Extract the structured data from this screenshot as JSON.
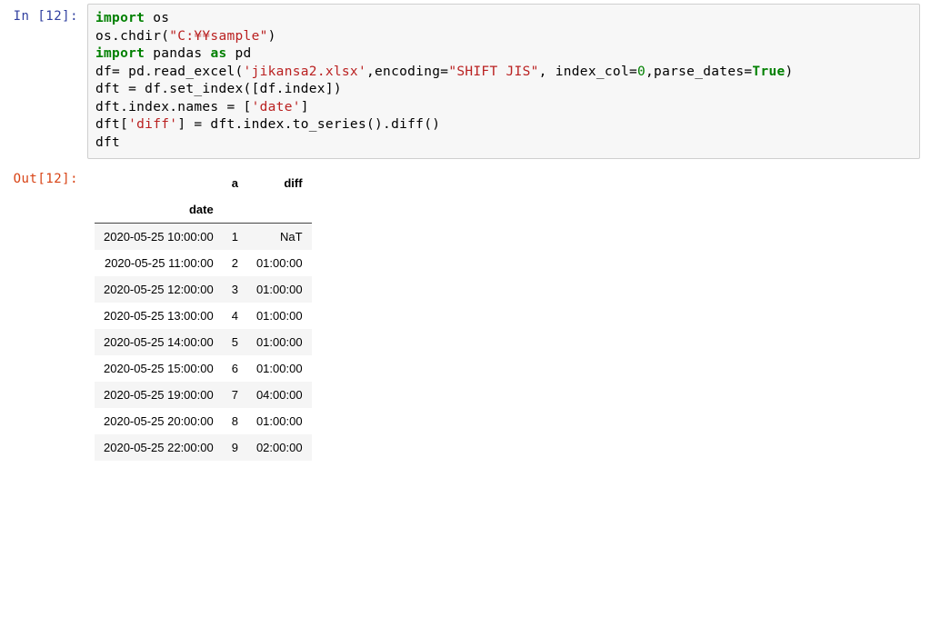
{
  "input": {
    "prompt": "In [12]:",
    "code": {
      "l1_kw1": "import",
      "l1_mod": " os",
      "l2_pre": "os.chdir(",
      "l2_str": "\"C:¥¥sample\"",
      "l2_post": ")",
      "l3_kw1": "import",
      "l3_mid": " pandas ",
      "l3_kw2": "as",
      "l3_alias": " pd",
      "l4_pre": "df= pd.read_excel(",
      "l4_str1": "'jikansa2.xlsx'",
      "l4_mid1": ",encoding=",
      "l4_str2": "\"SHIFT JIS\"",
      "l4_mid2": ", index_col=",
      "l4_num": "0",
      "l4_mid3": ",parse_dates=",
      "l4_true": "True",
      "l4_post": ")",
      "l5": "dft = df.set_index([df.index])",
      "l6_pre": "dft.index.names = [",
      "l6_str": "'date'",
      "l6_post": "]",
      "l7_pre": "dft[",
      "l7_str": "'diff'",
      "l7_post": "] = dft.index.to_series().diff()",
      "l8": "dft"
    }
  },
  "output": {
    "prompt": "Out[12]:",
    "dataframe": {
      "index_name": "date",
      "columns": [
        "a",
        "diff"
      ],
      "rows": [
        {
          "date": "2020-05-25 10:00:00",
          "a": "1",
          "diff": "NaT"
        },
        {
          "date": "2020-05-25 11:00:00",
          "a": "2",
          "diff": "01:00:00"
        },
        {
          "date": "2020-05-25 12:00:00",
          "a": "3",
          "diff": "01:00:00"
        },
        {
          "date": "2020-05-25 13:00:00",
          "a": "4",
          "diff": "01:00:00"
        },
        {
          "date": "2020-05-25 14:00:00",
          "a": "5",
          "diff": "01:00:00"
        },
        {
          "date": "2020-05-25 15:00:00",
          "a": "6",
          "diff": "01:00:00"
        },
        {
          "date": "2020-05-25 19:00:00",
          "a": "7",
          "diff": "04:00:00"
        },
        {
          "date": "2020-05-25 20:00:00",
          "a": "8",
          "diff": "01:00:00"
        },
        {
          "date": "2020-05-25 22:00:00",
          "a": "9",
          "diff": "02:00:00"
        }
      ]
    }
  }
}
